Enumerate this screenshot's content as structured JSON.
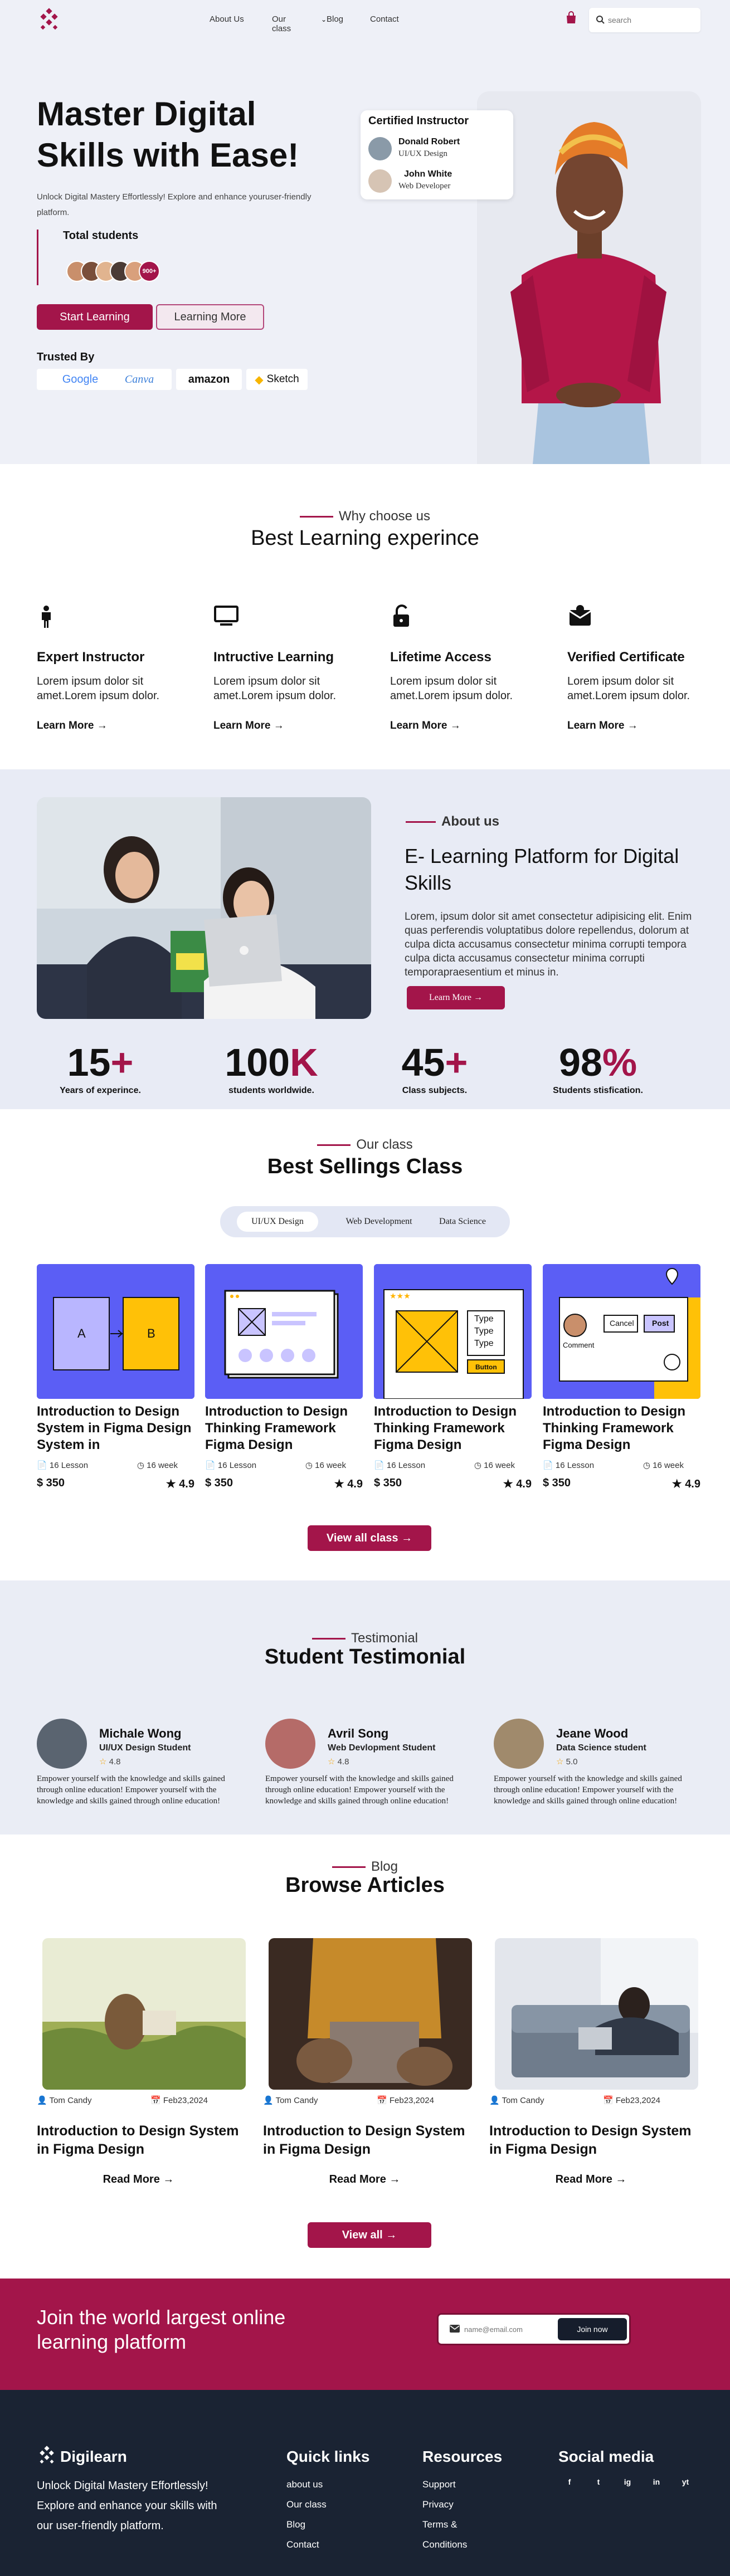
{
  "colors": {
    "accent": "#a3154a",
    "hero_bg": "#eef0f7",
    "card_blue": "#5b5ef5",
    "footer_bg": "#1a2333"
  },
  "nav": {
    "links": [
      "About Us",
      "Our class",
      "Blog",
      "Contact"
    ],
    "search_placeholder": "search"
  },
  "hero": {
    "title_line1": "Master Digital",
    "title_line2": "Skills with Ease!",
    "subtitle": "Unlock Digital Mastery Effortlessly! Explore and enhance youruser-friendly platform.",
    "students_title": "Total students",
    "students_more": "900+",
    "primary_button": "Start Learning",
    "secondary_button": "Learning More",
    "trusted_title": "Trusted By",
    "brands": [
      "Google",
      "Canva",
      "amazon",
      "Sketch"
    ],
    "certified": {
      "title": "Certified Instructor",
      "people": [
        {
          "name": "Donald Robert",
          "role": "UI/UX Design"
        },
        {
          "name": "John White",
          "role": "Web Developer"
        }
      ]
    }
  },
  "why": {
    "eyebrow": "Why choose us",
    "title": "Best Learning experince",
    "features": [
      {
        "icon": "person-icon",
        "title": "Expert Instructor",
        "desc_line1": "Lorem ipsum dolor sit",
        "desc_line2": "amet.Lorem ipsum dolor.",
        "link": "Learn More →"
      },
      {
        "icon": "monitor-icon",
        "title": "Intructive Learning",
        "desc_line1": "Lorem ipsum dolor sit",
        "desc_line2": "amet.Lorem ipsum dolor.",
        "link": "Learn More →"
      },
      {
        "icon": "unlock-icon",
        "title": "Lifetime Access",
        "desc_line1": "Lorem ipsum dolor sit",
        "desc_line2": "amet.Lorem ipsum dolor.",
        "link": "Learn More →"
      },
      {
        "icon": "certificate-icon",
        "title": "Verified Certificate",
        "desc_line1": "Lorem ipsum dolor sit",
        "desc_line2": "amet.Lorem ipsum dolor.",
        "link": "Learn More →"
      }
    ]
  },
  "about": {
    "eyebrow": "About us",
    "title": "E- Learning Platform for Digital Skills",
    "text": "Lorem, ipsum dolor sit amet consectetur adipisicing elit. Enim quas perferendis voluptatibus dolore repellendus, dolorum at culpa dicta accusamus consectetur minima corrupti tempora culpa dicta accusamus consectetur minima corrupti temporapraesentium et minus in.",
    "button": "Learn More →",
    "stats": [
      {
        "num": "15",
        "suffix": "+",
        "label": "Years of experince."
      },
      {
        "num": "100",
        "suffix": "K",
        "label": "students worldwide."
      },
      {
        "num": "45",
        "suffix": "+",
        "label": "Class subjects."
      },
      {
        "num": "98",
        "suffix": "%",
        "label": "Students stisfication."
      }
    ]
  },
  "classes": {
    "eyebrow": "Our class",
    "title": "Best Sellings Class",
    "tabs": [
      "UI/UX Design",
      "Web Development",
      "Data Science"
    ],
    "cards": [
      {
        "title": "Introduction to Design System in Figma Design System in",
        "lessons": "16 Lesson",
        "weeks": "16 week",
        "price": "$ 350",
        "rating": "4.9"
      },
      {
        "title": "Introduction to Design Thinking Framework Figma Design",
        "lessons": "16 Lesson",
        "weeks": "16 week",
        "price": "$ 350",
        "rating": "4.9"
      },
      {
        "title": "Introduction to Design Thinking Framework Figma Design",
        "lessons": "16 Lesson",
        "weeks": "16 week",
        "price": "$ 350",
        "rating": "4.9"
      },
      {
        "title": "Introduction to Design Thinking Framework Figma Design",
        "lessons": "16 Lesson",
        "weeks": "16 week",
        "price": "$ 350",
        "rating": "4.9"
      }
    ],
    "card1_labels": {
      "a": "A",
      "b": "B"
    },
    "card3_labels": {
      "t1": "Type",
      "t2": "Type",
      "t3": "Type",
      "button": "Button"
    },
    "card4_labels": {
      "cancel": "Cancel",
      "post": "Post",
      "comment": "Comment"
    },
    "view_all": "View all class →"
  },
  "testimonial": {
    "eyebrow": "Testimonial",
    "title": "Student Testimonial",
    "items": [
      {
        "name": "Michale Wong",
        "role": "UI/UX Design Student",
        "rating": "4.8",
        "text": "Empower yourself with the knowledge and skills gained through online education! Empower yourself with the knowledge and skills gained through online education!"
      },
      {
        "name": "Avril Song",
        "role": "Web Devlopment Student",
        "rating": "4.8",
        "text": "Empower yourself with the knowledge and skills gained through online education! Empower yourself with the knowledge and skills gained through online education!"
      },
      {
        "name": "Jeane Wood",
        "role": "Data Science student",
        "rating": "5.0",
        "text": "Empower yourself with the knowledge and skills gained through online education! Empower yourself with the knowledge and skills gained through online education!"
      }
    ]
  },
  "blog": {
    "eyebrow": "Blog",
    "title": "Browse Articles",
    "posts": [
      {
        "author": "Tom Candy",
        "date": "Feb23,2024",
        "title": "Introduction to Design System in Figma Design",
        "read": "Read More →"
      },
      {
        "author": "Tom Candy",
        "date": "Feb23,2024",
        "title": "Introduction to Design System in Figma Design",
        "read": "Read More →"
      },
      {
        "author": "Tom Candy",
        "date": "Feb23,2024",
        "title": "Introduction to Design System in Figma Design",
        "read": "Read More →"
      }
    ],
    "view_all": "View all →"
  },
  "cta": {
    "title": "Join the world largest online learning platform",
    "email_placeholder": "name@email.com",
    "button": "Join now"
  },
  "footer": {
    "brand": "Digilearn",
    "desc": "Unlock Digital Mastery Effortlessly! Explore and enhance your skills with our user-friendly platform.",
    "quick_title": "Quick links",
    "quick_links": [
      "about us",
      "Our class",
      "Blog",
      "Contact"
    ],
    "res_title": "Resources",
    "res_links": [
      "Support",
      "Privacy",
      "Terms &",
      "Conditions"
    ],
    "social_title": "Social media",
    "socials": [
      "f",
      "t",
      "ig",
      "in",
      "yt"
    ]
  }
}
